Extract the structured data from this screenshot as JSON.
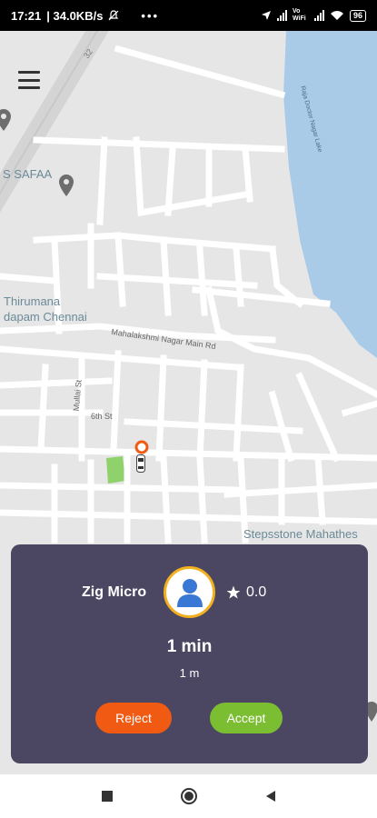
{
  "status_bar": {
    "time": "17:21",
    "network_speed": "| 34.0KB/s",
    "dots": "•••",
    "carrier_label": "Vo WiFi",
    "battery": "96"
  },
  "map": {
    "labels": {
      "lake": "Raja Doctor Nagar Lake",
      "safaa": "S SAFAA",
      "thirumana_1": "Thirumana",
      "thirumana_2": "dapam Chennai",
      "mahalakshmi_road": "Mahalakshmi Nagar Main Rd",
      "mullai_st": "Mullai St",
      "sixth_st": "6th St",
      "stepsstone": "Stepsstone Mahathes",
      "route_number": "32"
    },
    "colors": {
      "water": "#aacbe8",
      "park": "#8fd16b",
      "road": "#ffffff",
      "land": "#e6e6e6"
    }
  },
  "ride_request": {
    "vehicle_type": "Zig Micro",
    "rating": "0.0",
    "eta": "1 min",
    "distance": "1 m",
    "reject_label": "Reject",
    "accept_label": "Accept",
    "colors": {
      "card": "#4b4763",
      "reject": "#f05a12",
      "accept": "#7cbe31",
      "avatar_ring": "#f2b01e"
    }
  },
  "icons": {
    "menu": "hamburger-icon",
    "avatar": "user-icon",
    "rating": "star-icon",
    "location": "map-pin-icon",
    "car": "car-icon"
  }
}
